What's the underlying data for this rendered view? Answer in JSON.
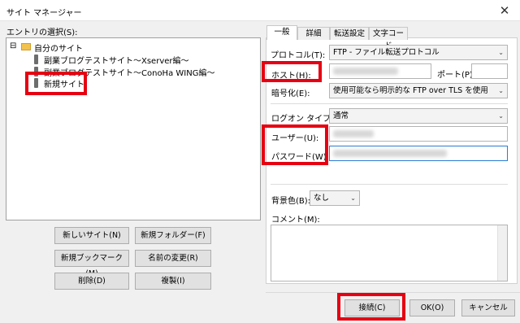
{
  "window": {
    "title": "サイト マネージャー",
    "close_glyph": "✕"
  },
  "left": {
    "entry_label": "エントリの選択(S):",
    "tree": {
      "expander": "⊟",
      "root": "自分のサイト",
      "items": [
        "副業ブログテストサイト～Xserver編～",
        "副業ブログテストサイト～ConoHa WING編～",
        "新規サイト"
      ]
    },
    "buttons": {
      "new_site": "新しいサイト(N)",
      "new_folder": "新規フォルダー(F)",
      "new_bookmark": "新規ブックマーク(M)",
      "rename": "名前の変更(R)",
      "delete": "削除(D)",
      "duplicate": "複製(I)"
    }
  },
  "tabs": [
    "一般",
    "詳細",
    "転送設定",
    "文字コード"
  ],
  "general": {
    "protocol_label": "プロトコル(T):",
    "protocol_value": "FTP - ファイル転送プロトコル",
    "host_label": "ホスト(H):",
    "port_label": "ポート(P):",
    "encryption_label": "暗号化(E):",
    "encryption_value": "使用可能なら明示的な FTP over TLS を使用",
    "logon_label": "ログオン タイプ(L):",
    "logon_value": "通常",
    "user_label": "ユーザー(U):",
    "password_label": "パスワード(W):",
    "bgcolor_label": "背景色(B):",
    "bgcolor_value": "なし",
    "comment_label": "コメント(M):"
  },
  "footer": {
    "connect": "接続(C)",
    "ok": "OK(O)",
    "cancel": "キャンセル"
  },
  "colors": {
    "highlight_box": "#e60012",
    "folder": "#f2c24f",
    "focus_border": "#2b7bd3"
  },
  "icons": {
    "dropdown": "chevron-down-icon",
    "arrow_glyph": "⌄"
  }
}
